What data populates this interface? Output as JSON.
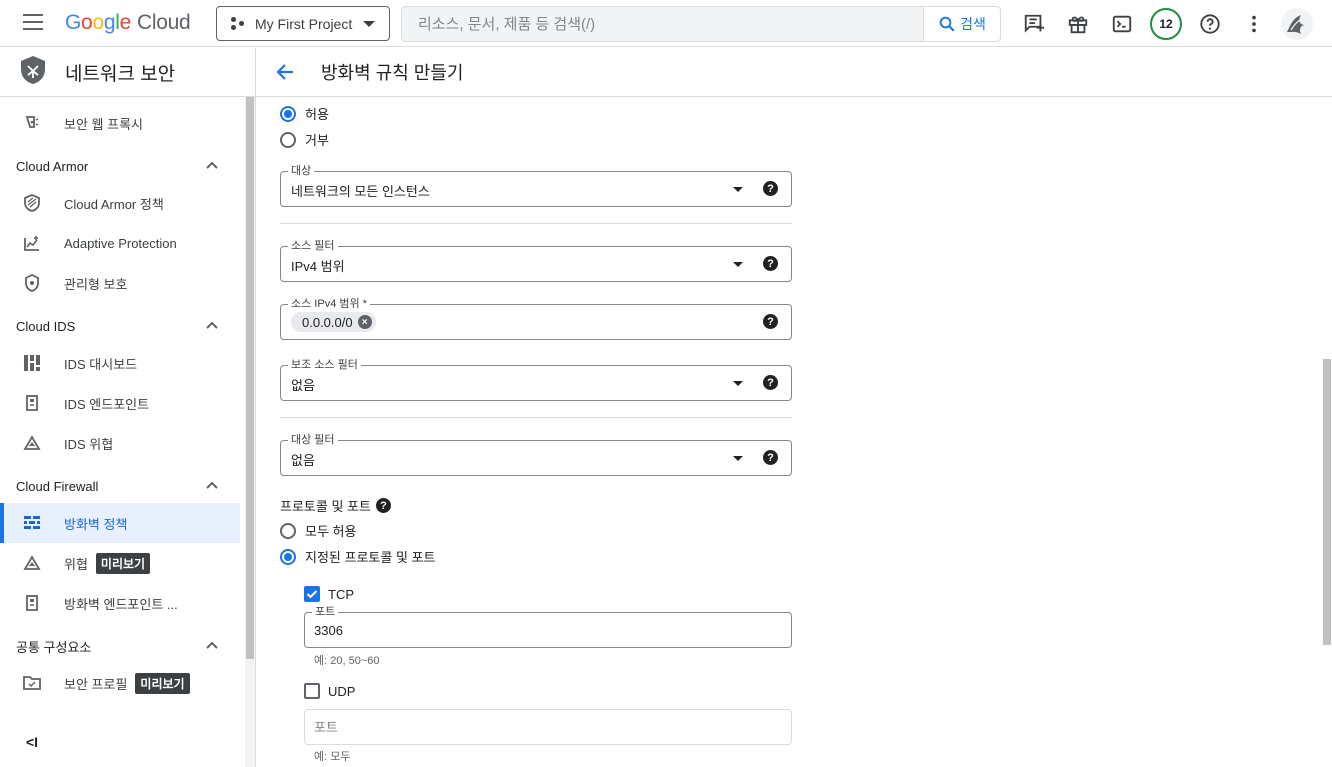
{
  "topbar": {
    "logo_letters": [
      "G",
      "o",
      "o",
      "g",
      "l",
      "e"
    ],
    "logo_cloud": "Cloud",
    "project": "My First Project",
    "search_placeholder": "리소스, 문서, 제품 등 검색(/)",
    "search_button": "검색",
    "notification_count": "12",
    "icons": [
      "menu-icon",
      "grid-dots-icon",
      "search-icon",
      "notes-icon",
      "gift-icon",
      "terminal-icon",
      "help-icon",
      "more-vert-icon",
      "avatar"
    ]
  },
  "sidebar": {
    "title": "네트워크 보안",
    "items": [
      {
        "label": "보안 웹 프록시",
        "icon": "proxy-icon"
      },
      {
        "label": "Cloud Armor",
        "section": true
      },
      {
        "label": "Cloud Armor 정책",
        "icon": "armor-policy-icon"
      },
      {
        "label": "Adaptive Protection",
        "icon": "adaptive-protection-icon"
      },
      {
        "label": "관리형 보호",
        "icon": "managed-protection-icon"
      },
      {
        "label": "Cloud IDS",
        "section": true
      },
      {
        "label": "IDS 대시보드",
        "icon": "dashboard-icon"
      },
      {
        "label": "IDS 엔드포인트",
        "icon": "endpoint-icon"
      },
      {
        "label": "IDS 위협",
        "icon": "threat-icon"
      },
      {
        "label": "Cloud Firewall",
        "section": true
      },
      {
        "label": "방화벽 정책",
        "icon": "firewall-icon",
        "active": true
      },
      {
        "label": "위협",
        "icon": "threat-icon",
        "badge": "미리보기"
      },
      {
        "label": "방화벽 엔드포인트 ...",
        "icon": "endpoint-icon"
      },
      {
        "label": "공통 구성요소",
        "section": true
      },
      {
        "label": "보안 프로필",
        "icon": "security-profile-icon",
        "badge": "미리보기"
      }
    ],
    "collapse_label": "<I"
  },
  "main": {
    "title": "방화벽 규칙 만들기",
    "action": {
      "options": [
        "허용",
        "거부"
      ],
      "selected": "허용"
    },
    "target": {
      "label": "대상",
      "value": "네트워크의 모든 인스턴스"
    },
    "source_filter": {
      "label": "소스 필터",
      "value": "IPv4 범위"
    },
    "source_ranges": {
      "label": "소스 IPv4 범위 *",
      "chips": [
        "0.0.0.0/0"
      ]
    },
    "secondary_source_filter": {
      "label": "보조 소스 필터",
      "value": "없음"
    },
    "destination_filter": {
      "label": "대상 필터",
      "value": "없음"
    },
    "protocols": {
      "title": "프로토콜 및 포트",
      "options": [
        "모두 허용",
        "지정된 프로토콜 및 포트"
      ],
      "selected": "지정된 프로토콜 및 포트",
      "tcp": {
        "label": "TCP",
        "checked": true,
        "port_label": "포트",
        "port_value": "3306",
        "hint": "예: 20, 50~60"
      },
      "udp": {
        "label": "UDP",
        "checked": false,
        "port_placeholder": "포트",
        "hint": "예: 모두"
      }
    }
  },
  "colors": {
    "accent": "#1a73e8",
    "active_bg": "#e8f0fe",
    "badge_bg": "#3c4043",
    "check_green": "#1e8e3e"
  }
}
